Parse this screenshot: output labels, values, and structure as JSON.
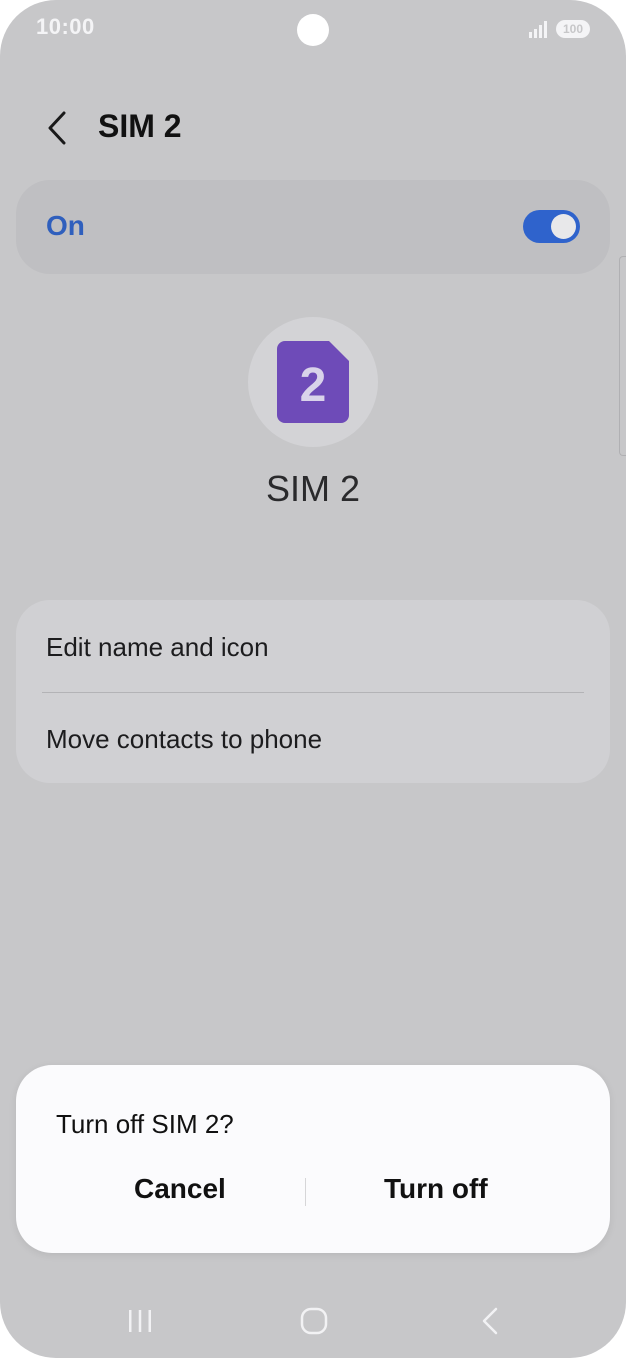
{
  "status_bar": {
    "time": "10:00",
    "battery": "100",
    "icons": [
      "camera-cutout",
      "signal-icon",
      "battery-icon"
    ]
  },
  "header": {
    "title": "SIM 2",
    "back_icon": "chevron-left-icon"
  },
  "sim_switch": {
    "label": "On",
    "state": "on",
    "accent_color": "#2f63cc"
  },
  "sim": {
    "badge_number": "2",
    "name": "SIM 2",
    "badge_color": "#6e4bb8"
  },
  "options": [
    {
      "label": "Edit name and icon"
    },
    {
      "label": "Move contacts to phone"
    }
  ],
  "dialog": {
    "title": "Turn off SIM 2?",
    "cancel_label": "Cancel",
    "confirm_label": "Turn off"
  },
  "nav_bar": {
    "icons": [
      "recents-icon",
      "home-icon",
      "back-icon"
    ]
  }
}
